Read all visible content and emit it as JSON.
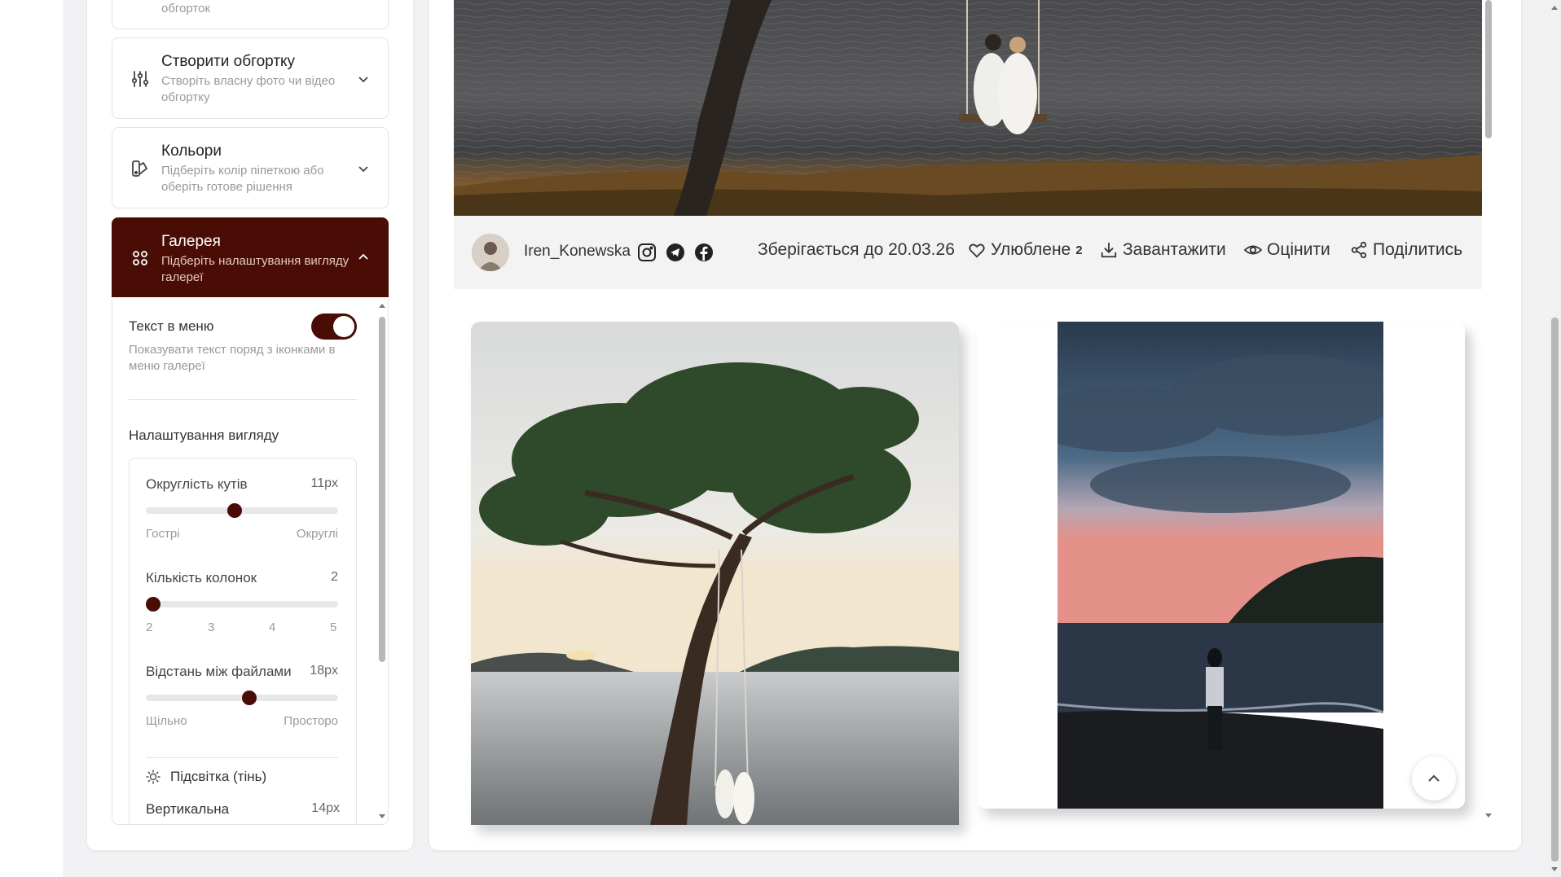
{
  "sidebar": {
    "top_item": {
      "subtitle_fragment": "обгорток"
    },
    "items": [
      {
        "icon": "sliders-icon",
        "title": "Створити обгортку",
        "subtitle": "Створіть власну фото чи відео обгортку"
      },
      {
        "icon": "palette-icon",
        "title": "Кольори",
        "subtitle": "Підберіть колір піпеткою або оберіть готове рішення"
      },
      {
        "icon": "grid-icon",
        "title": "Галерея",
        "subtitle": "Підберіть налаштування вигляду галереї",
        "active": true
      }
    ],
    "gallery_settings": {
      "text_in_menu": {
        "label": "Текст в меню",
        "hint": "Показувати текст поряд з іконками в меню галереї",
        "enabled": true
      },
      "appearance_heading": "Налаштування вигляду",
      "corner_radius": {
        "label": "Округлість кутів",
        "value_text": "11px",
        "value": 11,
        "min_label": "Гострі",
        "max_label": "Округлі",
        "fraction": 0.46
      },
      "columns": {
        "label": "Кількість колонок",
        "value_text": "2",
        "value": 2,
        "ticks": [
          "2",
          "3",
          "4",
          "5"
        ]
      },
      "gap": {
        "label": "Відстань між файлами",
        "value_text": "18px",
        "value": 18,
        "min_label": "Щільно",
        "max_label": "Просторо",
        "fraction": 0.54
      },
      "shadow": {
        "label": "Підсвітка (тінь)"
      },
      "vertical": {
        "label": "Вертикальна",
        "value_text": "14px"
      }
    }
  },
  "gallery": {
    "author": "Iren_Konewska",
    "socials": [
      "instagram-icon",
      "telegram-icon",
      "facebook-icon"
    ],
    "stored_until": "Зберігається до 20.03.26",
    "favorite": {
      "label": "Улюблене",
      "count": "2"
    },
    "download_label": "Завантажити",
    "rate_label": "Оцінити",
    "share_label": "Поділитись"
  },
  "colors": {
    "accent": "#4a0d05"
  }
}
